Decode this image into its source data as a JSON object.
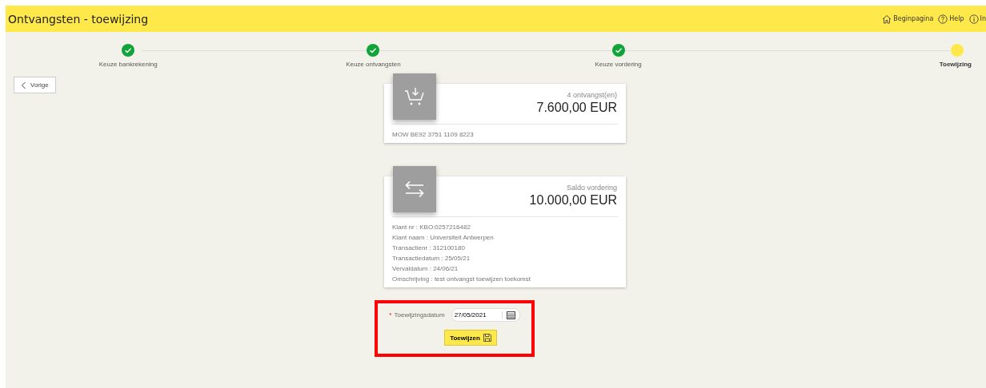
{
  "window": {
    "title": "Ontvangsten - toewijzing"
  },
  "header_links": [
    {
      "kind": "home",
      "label": "Beginpagina"
    },
    {
      "kind": "help",
      "label": "Help"
    },
    {
      "kind": "info",
      "label": "In"
    }
  ],
  "steps": [
    {
      "label": "Keuze bankrekening",
      "completed": true
    },
    {
      "label": "Keuze ontvangsten",
      "completed": true
    },
    {
      "label": "Keuze vordering",
      "completed": true
    },
    {
      "label": "Toewijzing",
      "completed": false
    }
  ],
  "back_button": {
    "label": "Vorige"
  },
  "cards": [
    {
      "kind": "receipts",
      "caption": "4 ontvangst(en)",
      "amount": "7.600,00 EUR",
      "details": [
        "MOW BE92 3751 1109 8223"
      ]
    },
    {
      "kind": "claim",
      "caption": "Saldo vordering",
      "amount": "10.000,00 EUR",
      "details": [
        "Klant nr : KBO:0257216482",
        "Klant naam : Universiteit Antwerpen",
        "Transactienr : 312100180",
        "Transactiedatum : 25/05/21",
        "Vervaldatum : 24/06/21",
        "Omschrijving : test ontvangst toewijzen toekomst"
      ]
    }
  ],
  "form": {
    "label": "Toewijzingsdatum",
    "required_mark": "*",
    "value": "27/05/2021",
    "highlighted": true,
    "button": "Toewijzen"
  }
}
